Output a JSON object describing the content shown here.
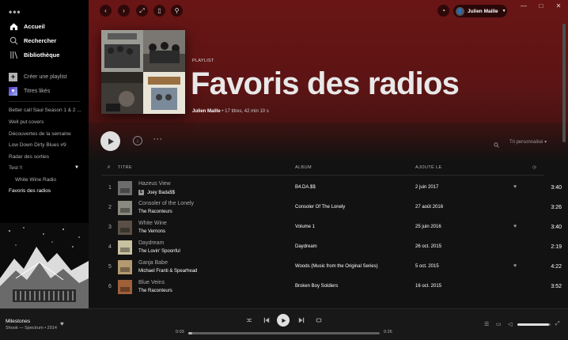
{
  "window": {
    "minimize_icon": "minimize-icon",
    "maximize_icon": "maximize-icon",
    "close_icon": "close-icon"
  },
  "sidebar": {
    "nav": [
      {
        "label": "Accueil",
        "icon": "home-icon"
      },
      {
        "label": "Rechercher",
        "icon": "search-icon"
      },
      {
        "label": "Bibliothèque",
        "icon": "library-icon"
      }
    ],
    "create_playlist": "Créer une playlist",
    "liked_songs": "Titres likés",
    "playlists": [
      {
        "label": "Better call Saul Season 1 & 2 ...",
        "active": false,
        "sub": false
      },
      {
        "label": "Well put covers",
        "active": false,
        "sub": false
      },
      {
        "label": "Découvertes de la semaine",
        "active": false,
        "sub": false
      },
      {
        "label": "Low Down Dirty Blues #9",
        "active": false,
        "sub": false
      },
      {
        "label": "Radar des sorties",
        "active": false,
        "sub": false
      },
      {
        "label": "Test !!",
        "active": false,
        "sub": false
      },
      {
        "label": "White Wine Radio",
        "active": false,
        "sub": true
      },
      {
        "label": "Favoris des radios",
        "active": true,
        "sub": false
      }
    ]
  },
  "header": {
    "user_name": "Julien Maille"
  },
  "playlist": {
    "type": "PLAYLIST",
    "title": "Favoris des radios",
    "owner": "Julien Maille",
    "meta": " • 17 titres, 42 min 10 s",
    "sort_label": "Tri personnalisé"
  },
  "table": {
    "headers": {
      "num": "#",
      "title": "TITRE",
      "album": "ALBUM",
      "added": "AJOUTÉ LE"
    },
    "rows": [
      {
        "num": "1",
        "title": "Hazeus View",
        "artist": "Joey Bada$$",
        "explicit": true,
        "album": "B4.DA.$$",
        "added": "2 juin 2017",
        "liked": true,
        "duration": "3:40",
        "thumb_color": "#6d6d6d"
      },
      {
        "num": "2",
        "title": "Consoler of the Lonely",
        "artist": "The Raconteurs",
        "explicit": false,
        "album": "Consoler Of The Lonely",
        "added": "27 août 2016",
        "liked": false,
        "duration": "3:26",
        "thumb_color": "#8a8a80"
      },
      {
        "num": "3",
        "title": "White Wine",
        "artist": "The Vernons",
        "explicit": false,
        "album": "Volume 1",
        "added": "25 juin 2016",
        "liked": true,
        "duration": "3:40",
        "thumb_color": "#5a5048"
      },
      {
        "num": "4",
        "title": "Daydream",
        "artist": "The Lovin' Spoonful",
        "explicit": false,
        "album": "Daydream",
        "added": "26 oct. 2015",
        "liked": false,
        "duration": "2:19",
        "thumb_color": "#c9c2a0"
      },
      {
        "num": "5",
        "title": "Ganja Babe",
        "artist": "Michael Franti & Spearhead",
        "explicit": false,
        "album": "Woods (Music from the Original Series)",
        "added": "5 oct. 2015",
        "liked": true,
        "duration": "4:22",
        "thumb_color": "#b49a70"
      },
      {
        "num": "6",
        "title": "Blue Veins",
        "artist": "The Raconteurs",
        "explicit": false,
        "album": "Broken Boy Soldiers",
        "added": "16 oct. 2015",
        "liked": false,
        "duration": "3:52",
        "thumb_color": "#a0603a"
      }
    ]
  },
  "player": {
    "track": "Milestones",
    "artist_line": "Shook — Spectrum • 2014",
    "time_current": "0:03",
    "time_total": "0:26",
    "progress": 0.02,
    "volume": 0.95
  }
}
